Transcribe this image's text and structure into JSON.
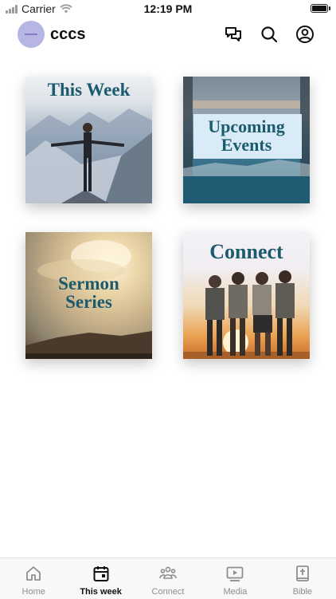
{
  "status_bar": {
    "carrier": "Carrier",
    "time": "12:19 PM"
  },
  "header": {
    "title": "cccs",
    "icons": [
      "chat-icon",
      "search-icon",
      "account-icon"
    ]
  },
  "tiles": [
    {
      "title": "This Week",
      "image": "man-on-mountain"
    },
    {
      "title": "Upcoming Events",
      "image": "lake-dusk"
    },
    {
      "title": "Sermon Series",
      "image": "sun-clouds-landscape"
    },
    {
      "title": "Connect",
      "image": "friends-sunset"
    }
  ],
  "tabs": [
    {
      "label": "Home",
      "icon": "home-icon",
      "active": false
    },
    {
      "label": "This week",
      "icon": "calendar-icon",
      "active": true
    },
    {
      "label": "Connect",
      "icon": "people-icon",
      "active": false
    },
    {
      "label": "Media",
      "icon": "play-icon",
      "active": false
    },
    {
      "label": "Bible",
      "icon": "bible-icon",
      "active": false
    }
  ],
  "colors": {
    "tile_title": "#1c5a6e",
    "active_tab": "#111111",
    "inactive_tab": "#8e8e8e",
    "avatar": "#b7b5e3"
  }
}
